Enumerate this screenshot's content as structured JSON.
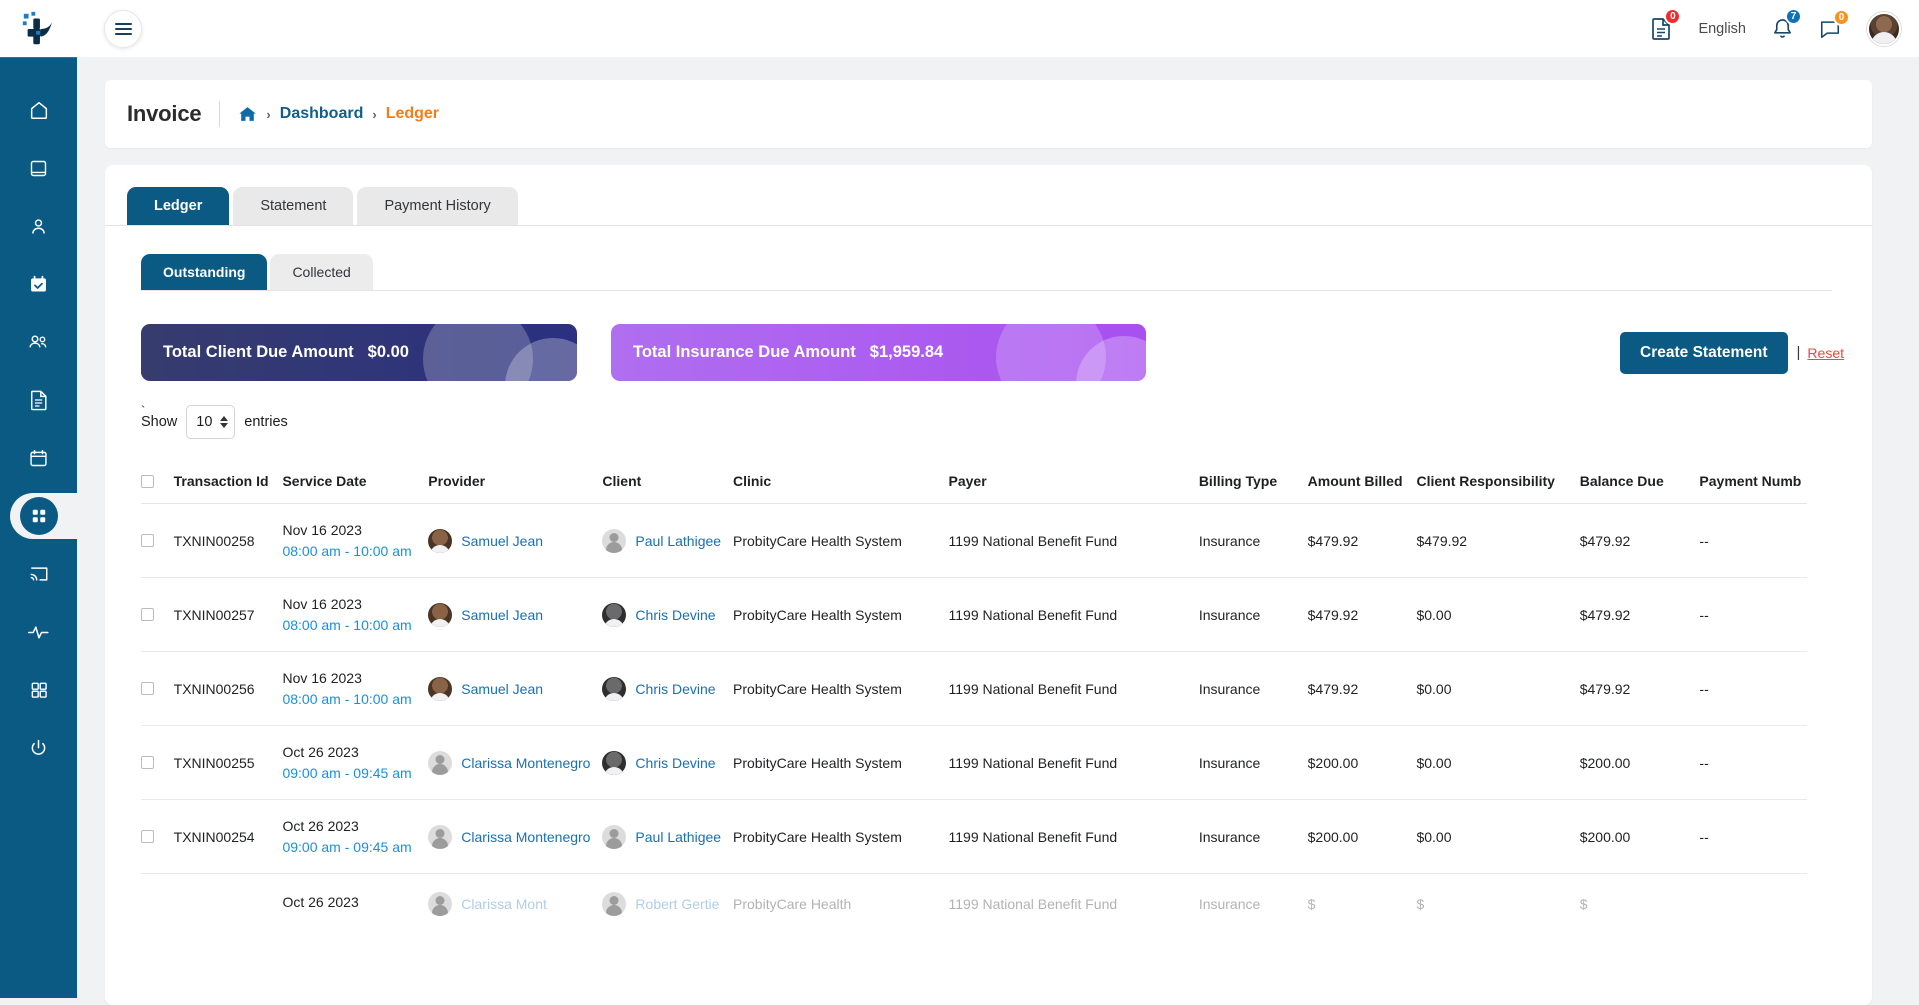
{
  "topbar": {
    "language": "English",
    "doc_badge": "0",
    "bell_badge": "7",
    "chat_badge": "0",
    "icons": {
      "menu": "hamburger-icon",
      "document": "document-icon",
      "bell": "bell-icon",
      "chat": "chat-icon",
      "avatar": "user-avatar"
    }
  },
  "sidebar": {
    "items": [
      {
        "name": "home",
        "icon": "home-icon"
      },
      {
        "name": "book",
        "icon": "book-icon"
      },
      {
        "name": "profile",
        "icon": "person-icon"
      },
      {
        "name": "scheduling",
        "icon": "calendar-check-icon"
      },
      {
        "name": "clients",
        "icon": "people-icon"
      },
      {
        "name": "documents",
        "icon": "file-text-icon"
      },
      {
        "name": "calendar",
        "icon": "calendar-icon"
      },
      {
        "name": "billing",
        "icon": "grid-circle-icon",
        "active": true
      },
      {
        "name": "telehealth",
        "icon": "cast-icon"
      },
      {
        "name": "reports",
        "icon": "activity-icon"
      },
      {
        "name": "apps",
        "icon": "apps-grid-icon"
      },
      {
        "name": "logout",
        "icon": "power-icon"
      }
    ]
  },
  "breadcrumb": {
    "title": "Invoice",
    "home_icon": "home-icon",
    "chevron": "›",
    "dashboard": "Dashboard",
    "current": "Ledger"
  },
  "tabs": [
    {
      "label": "Ledger",
      "active": true
    },
    {
      "label": "Statement",
      "active": false
    },
    {
      "label": "Payment History",
      "active": false
    }
  ],
  "subtabs": [
    {
      "label": "Outstanding",
      "active": true
    },
    {
      "label": "Collected",
      "active": false
    }
  ],
  "summary_cards": [
    {
      "label": "Total Client Due Amount",
      "amount": "$0.00",
      "color": "#2b3080"
    },
    {
      "label": "Total Insurance Due Amount",
      "amount": "$1,959.84",
      "color": "#a84ff0"
    }
  ],
  "actions": {
    "create_statement": "Create Statement",
    "separator": "|",
    "reset": "Reset"
  },
  "table_controls": {
    "tick_mark": "`",
    "show_label": "Show",
    "entries_value": "10",
    "entries_label": "entries"
  },
  "table": {
    "columns": [
      "Transaction Id",
      "Service Date",
      "Provider",
      "Client",
      "Clinic",
      "Payer",
      "Billing Type",
      "Amount Billed",
      "Client Responsibility",
      "Balance Due",
      "Payment Numb"
    ],
    "rows": [
      {
        "transaction_id": "TXNIN00258",
        "service_date": "Nov 16 2023",
        "service_time": "08:00 am - 10:00 am",
        "provider": "Samuel Jean",
        "provider_avatar": "brown",
        "client": "Paul Lathigee",
        "client_avatar": "gray",
        "clinic": "ProbityCare Health System",
        "payer": "1199 National Benefit Fund",
        "billing_type": "Insurance",
        "amount_billed": "$479.92",
        "client_responsibility": "$479.92",
        "balance_due": "$479.92",
        "payment_number": "--"
      },
      {
        "transaction_id": "TXNIN00257",
        "service_date": "Nov 16 2023",
        "service_time": "08:00 am - 10:00 am",
        "provider": "Samuel Jean",
        "provider_avatar": "brown",
        "client": "Chris Devine",
        "client_avatar": "dark",
        "clinic": "ProbityCare Health System",
        "payer": "1199 National Benefit Fund",
        "billing_type": "Insurance",
        "amount_billed": "$479.92",
        "client_responsibility": "$0.00",
        "balance_due": "$479.92",
        "payment_number": "--"
      },
      {
        "transaction_id": "TXNIN00256",
        "service_date": "Nov 16 2023",
        "service_time": "08:00 am - 10:00 am",
        "provider": "Samuel Jean",
        "provider_avatar": "brown",
        "client": "Chris Devine",
        "client_avatar": "dark",
        "clinic": "ProbityCare Health System",
        "payer": "1199 National Benefit Fund",
        "billing_type": "Insurance",
        "amount_billed": "$479.92",
        "client_responsibility": "$0.00",
        "balance_due": "$479.92",
        "payment_number": "--"
      },
      {
        "transaction_id": "TXNIN00255",
        "service_date": "Oct 26 2023",
        "service_time": "09:00 am - 09:45 am",
        "provider": "Clarissa Montenegro",
        "provider_avatar": "gray",
        "client": "Chris Devine",
        "client_avatar": "dark",
        "clinic": "ProbityCare Health System",
        "payer": "1199 National Benefit Fund",
        "billing_type": "Insurance",
        "amount_billed": "$200.00",
        "client_responsibility": "$0.00",
        "balance_due": "$200.00",
        "payment_number": "--"
      },
      {
        "transaction_id": "TXNIN00254",
        "service_date": "Oct 26 2023",
        "service_time": "09:00 am - 09:45 am",
        "provider": "Clarissa Montenegro",
        "provider_avatar": "gray",
        "client": "Paul Lathigee",
        "client_avatar": "gray",
        "clinic": "ProbityCare Health System",
        "payer": "1199 National Benefit Fund",
        "billing_type": "Insurance",
        "amount_billed": "$200.00",
        "client_responsibility": "$0.00",
        "balance_due": "$200.00",
        "payment_number": "--"
      },
      {
        "transaction_id": "",
        "service_date": "Oct 26 2023",
        "service_time": "",
        "provider": "Clarissa Mont",
        "provider_avatar": "gray",
        "client": "Robert Gertie",
        "client_avatar": "gray",
        "clinic": "ProbityCare Health",
        "payer": "1199 National Benefit Fund",
        "billing_type": "Insurance",
        "amount_billed": "$",
        "client_responsibility": "$",
        "balance_due": "$",
        "payment_number": ""
      }
    ]
  }
}
